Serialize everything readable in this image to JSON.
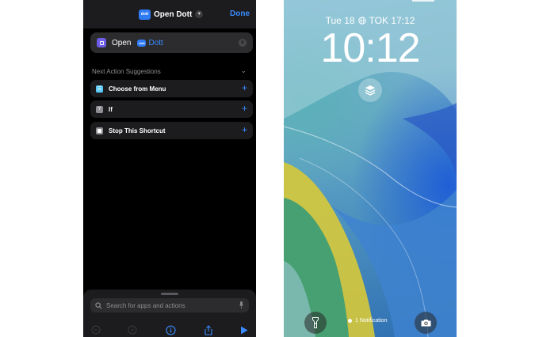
{
  "shortcuts": {
    "title": "Open Dott",
    "app_tile_text": "dott",
    "done_label": "Done",
    "action": {
      "verb": "Open",
      "app": "Dott"
    },
    "suggestions_header": "Next Action Suggestions",
    "suggestions": [
      {
        "label": "Choose from Menu",
        "icon": "menu-icon",
        "color": "#5ac8fa"
      },
      {
        "label": "If",
        "icon": "branch-icon",
        "color": "#8e8e93"
      },
      {
        "label": "Stop This Shortcut",
        "icon": "stop-icon",
        "color": "#8e8e93"
      }
    ],
    "search": {
      "placeholder": "Search for apps and actions"
    },
    "toolbar": [
      "undo-icon",
      "redo-icon",
      "info-icon",
      "share-icon",
      "play-icon"
    ],
    "accent": "#3a8bff"
  },
  "lockscreen": {
    "date": "Tue 18",
    "world_clock": "TOK 17:12",
    "time": "10:12",
    "notification": "1 Notification",
    "buttons": [
      "flashlight-icon",
      "camera-icon"
    ]
  }
}
